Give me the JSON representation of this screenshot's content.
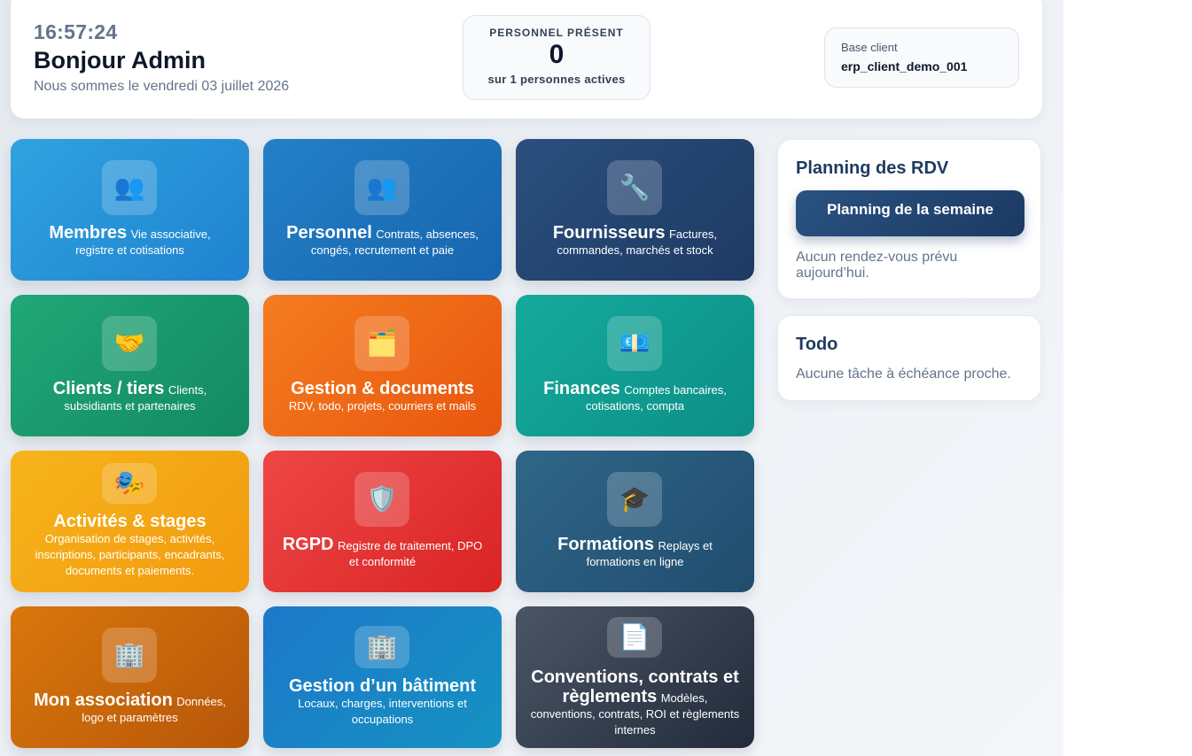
{
  "header": {
    "clock": "16:57:24",
    "greeting": "Bonjour Admin",
    "date_line": "Nous sommes le vendredi 03 juillet 2026",
    "staff": {
      "title": "PERSONNEL PRÉSENT",
      "count": "0",
      "subtitle": "sur 1 personnes actives"
    },
    "client_base": {
      "label": "Base client",
      "value": "erp_client_demo_001"
    }
  },
  "tiles": [
    {
      "icon": "👥",
      "icon_name": "people-icon",
      "title": "Membres",
      "desc_inline": "Vie associative,",
      "desc_rest": "registre et cotisations",
      "color": "#2fa3e0"
    },
    {
      "icon": "👥",
      "icon_name": "people-icon",
      "title": "Personnel",
      "desc_inline": "Contrats, absences,",
      "desc_rest": "congés, recrutement et paie",
      "color": "#2380c7"
    },
    {
      "icon": "🔧",
      "icon_name": "wrench-icon",
      "title": "Fournisseurs",
      "desc_inline": "Factures,",
      "desc_rest": "commandes, marchés et stock",
      "color": "#2b4f7e"
    },
    {
      "icon": "🤝",
      "icon_name": "handshake-icon",
      "title": "Clients / tiers",
      "desc_inline": "Clients,",
      "desc_rest": "subsidiants et partenaires",
      "color": "#20a777"
    },
    {
      "icon": "🗂️",
      "icon_name": "folder-icon",
      "title": "Gestion & documents",
      "desc_inline": "",
      "desc_rest": "RDV, todo, projets, courriers et mails",
      "color": "#f57c1f"
    },
    {
      "icon": "💶",
      "icon_name": "banknote-icon",
      "title": "Finances",
      "desc_inline": "Comptes bancaires,",
      "desc_rest": "cotisations, compta",
      "color": "#14aa9c"
    },
    {
      "icon": "🎭",
      "icon_name": "theater-masks-icon",
      "title": "Activités & stages",
      "desc_inline": "",
      "desc_rest": "Organisation de stages, activités, inscriptions, participants, encadrants, documents et paiements.",
      "color": "#f6b41b"
    },
    {
      "icon": "🛡️",
      "icon_name": "shield-icon",
      "title": "RGPD",
      "desc_inline": "Registre de traitement, DPO",
      "desc_rest": "et conformité",
      "color": "#ef4646"
    },
    {
      "icon": "🎓",
      "icon_name": "graduation-cap-icon",
      "title": "Formations",
      "desc_inline": "Replays et",
      "desc_rest": "formations en ligne",
      "color": "#2f6688"
    },
    {
      "icon": "🏢",
      "icon_name": "office-building-icon",
      "title": "Mon association",
      "desc_inline": "Données,",
      "desc_rest": "logo et paramètres",
      "color": "#d9770c"
    },
    {
      "icon": "🏢",
      "icon_name": "office-building-icon",
      "title": "Gestion d’un bâtiment",
      "desc_inline": "",
      "desc_rest": "Locaux, charges, interventions et occupations",
      "color": "#1d78c9"
    },
    {
      "icon": "📄",
      "icon_name": "document-icon",
      "title": "Conventions, contrats et règlements",
      "desc_inline": "Modèles,",
      "desc_rest": "conventions, contrats, ROI et règlements internes",
      "color": "#4a5566"
    }
  ],
  "planning": {
    "title": "Planning des RDV",
    "button_label": "Planning de la semaine",
    "empty_text": "Aucun rendez-vous prévu aujourd’hui."
  },
  "todo": {
    "title": "Todo",
    "empty_text": "Aucune tâche à échéance proche."
  }
}
